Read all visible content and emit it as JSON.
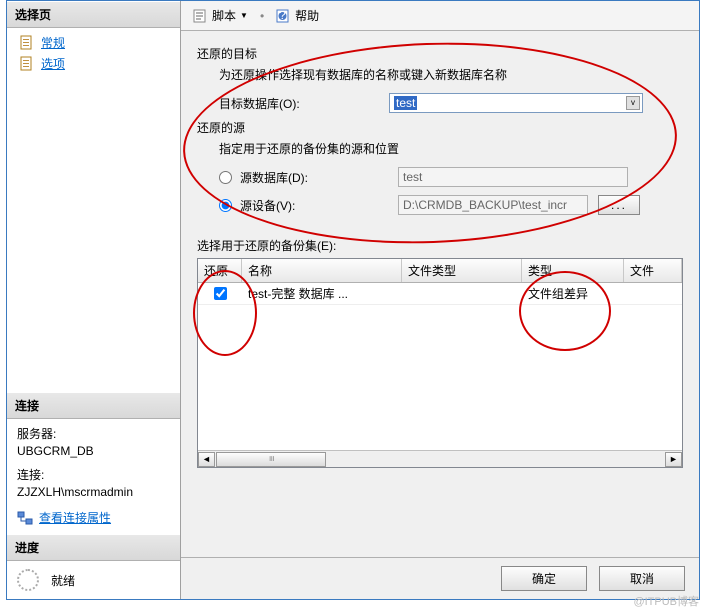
{
  "left": {
    "select_page_header": "选择页",
    "nav_general": "常规",
    "nav_options": "选项",
    "connection_header": "连接",
    "server_label": "服务器:",
    "server_value": "UBGCRM_DB",
    "connection_label": "连接:",
    "connection_value": "ZJZXLH\\mscrmadmin",
    "view_conn_props": "查看连接属性",
    "progress_header": "进度",
    "progress_status": "就绪"
  },
  "toolbar": {
    "script": "脚本",
    "help": "帮助"
  },
  "main": {
    "restore_target_title": "还原的目标",
    "restore_target_desc": "为还原操作选择现有数据库的名称或键入新数据库名称",
    "target_db_label": "目标数据库(O):",
    "target_db_value": "test",
    "restore_source_title": "还原的源",
    "restore_source_desc": "指定用于还原的备份集的源和位置",
    "source_db_label": "源数据库(D):",
    "source_db_value": "test",
    "source_device_label": "源设备(V):",
    "source_device_value": "D:\\CRMDB_BACKUP\\test_incr",
    "browse_btn": "...",
    "grid_title": "选择用于还原的备份集(E):",
    "grid_headers": {
      "restore": "还原",
      "name": "名称",
      "ftype": "文件类型",
      "type": "类型",
      "file": "文件"
    },
    "grid_row": {
      "name": "test-完整 数据库 ...",
      "type": "文件组差异"
    }
  },
  "buttons": {
    "ok": "确定",
    "cancel": "取消"
  },
  "watermark": "@ITPUB博客"
}
